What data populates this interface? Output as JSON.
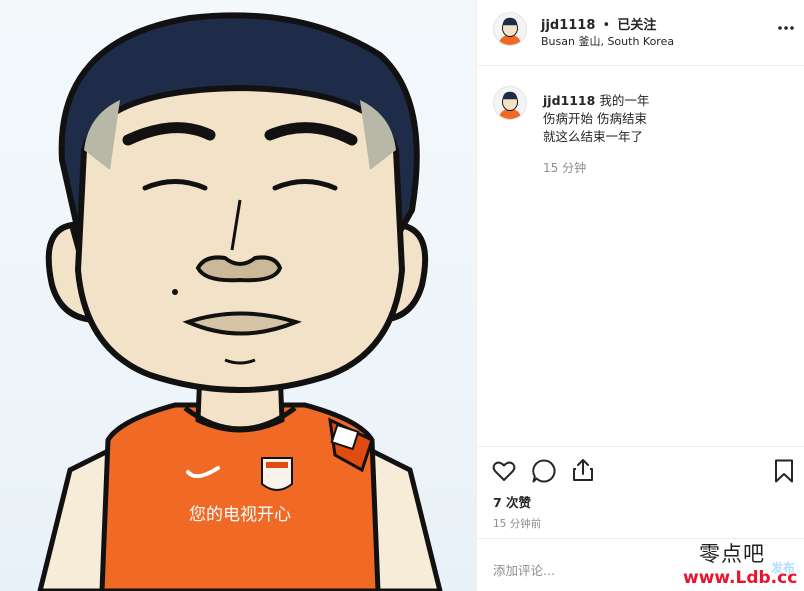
{
  "post": {
    "image_alt_icon": "cartoon-footballer-portrait",
    "jersey_text": "您的电视开心",
    "header": {
      "username": "jjd1118",
      "dot": "•",
      "follow_status": "已关注",
      "location": "Busan 釜山, South Korea",
      "more_icon": "more-horizontal-icon"
    },
    "caption": {
      "username": "jjd1118",
      "lines": [
        "我的一年",
        "伤病开始 伤病结束",
        "就这么结束一年了"
      ],
      "time": "15 分钟"
    },
    "actions": {
      "icons": [
        "heart-icon",
        "comment-icon",
        "share-icon",
        "bookmark-icon"
      ],
      "likes": "7 次赞",
      "time_ago": "15 分钟前"
    },
    "add_comment": {
      "placeholder": "添加评论...",
      "publish_label": "发布"
    },
    "watermark": {
      "line1": "零点吧",
      "line2": "www.Ldb.cc"
    },
    "colors": {
      "jersey_orange": "#f06a25",
      "publish_blue": "#b2dffc",
      "watermark_red": "#e8142e"
    }
  }
}
